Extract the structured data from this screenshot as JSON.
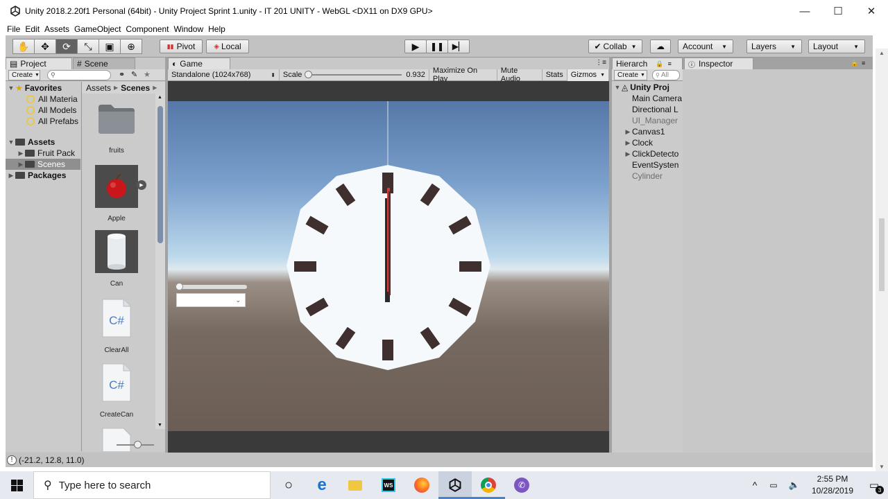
{
  "window": {
    "title": "Unity 2018.2.20f1 Personal (64bit) - Unity Project Sprint 1.unity - IT 201 UNITY - WebGL <DX11 on DX9 GPU>",
    "minimize": "—",
    "maximize": "☐",
    "close": "✕"
  },
  "menu": [
    "File",
    "Edit",
    "Assets",
    "GameObject",
    "Component",
    "Window",
    "Help"
  ],
  "toolbar": {
    "pivot": "Pivot",
    "local": "Local",
    "collab": "Collab",
    "account": "Account",
    "layers": "Layers",
    "layout": "Layout"
  },
  "project": {
    "tab": "Project",
    "scene_tab": "Scene",
    "create": "Create",
    "favorites": "Favorites",
    "fav_items": [
      "All Materia",
      "All Models",
      "All Prefabs"
    ],
    "assets": "Assets",
    "asset_children": [
      "Fruit Pack",
      "Scenes"
    ],
    "packages": "Packages",
    "crumb_root": "Assets",
    "crumb_current": "Scenes",
    "items": [
      "fruits",
      "Apple",
      "Can",
      "ClearAll",
      "CreateCan"
    ],
    "script_glyph": "C#"
  },
  "game": {
    "tab": "Game",
    "display": "Standalone (1024x768)",
    "scale_label": "Scale",
    "scale_value": "0.932",
    "maximize": "Maximize On Play",
    "mute": "Mute Audio",
    "stats": "Stats",
    "gizmos": "Gizmos"
  },
  "hierarchy": {
    "tab": "Hierarch",
    "create": "Create",
    "search": "All",
    "root": "Unity Proj",
    "items": [
      "Main Camera",
      "Directional L",
      "UI_Manager",
      "Canvas1",
      "Clock",
      "ClickDetecto",
      "EventSysten",
      "Cylinder"
    ]
  },
  "inspector": {
    "tab": "Inspector"
  },
  "status": {
    "text": "(-21.2, 12.8, 11.0)"
  },
  "taskbar": {
    "search_placeholder": "Type here to search",
    "time": "2:55 PM",
    "date": "10/28/2019",
    "notifications": "3"
  }
}
